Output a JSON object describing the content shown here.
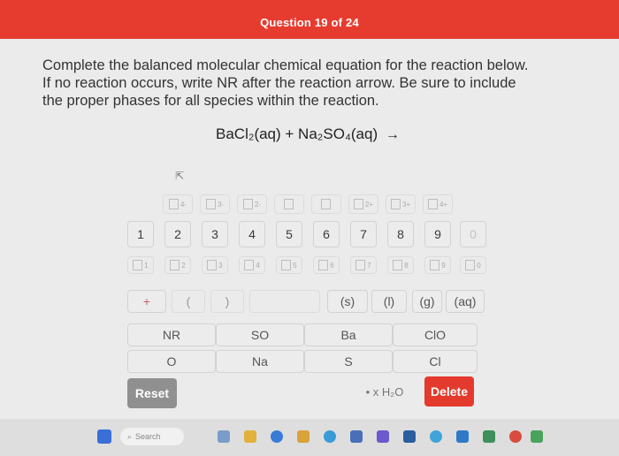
{
  "header": {
    "question_label": "Question 19 of 24"
  },
  "prompt": {
    "line1": "Complete the balanced molecular chemical equation for the reaction below.",
    "line2": "If no reaction occurs, write NR after the reaction arrow. Be sure to include",
    "line3": "the proper phases for all species within the reaction."
  },
  "equation": {
    "text": "BaCl₂(aq) + Na₂SO₄(aq)",
    "arrow": "→"
  },
  "keypad": {
    "charges": [
      "4-",
      "3-",
      "2-",
      "",
      "",
      "2+",
      "3+",
      "4+"
    ],
    "digits": [
      "1",
      "2",
      "3",
      "4",
      "5",
      "6",
      "7",
      "8",
      "9",
      "0"
    ],
    "subscripts": [
      "1",
      "2",
      "3",
      "4",
      "5",
      "6",
      "7",
      "8",
      "9",
      "0"
    ],
    "symbols": [
      "+",
      "(",
      ")",
      "",
      "(s)",
      "(l)",
      "(g)",
      "(aq)"
    ],
    "row_elements1": [
      "NR",
      "SO",
      "Ba",
      "ClO"
    ],
    "row_elements2": [
      "O",
      "Na",
      "S",
      "Cl"
    ],
    "water": "• x H₂O",
    "reset": "Reset",
    "delete": "Delete"
  },
  "taskbar": {
    "search_label": "Search"
  },
  "colors": {
    "accent": "#e63c2f",
    "reset_bg": "#909090",
    "delete_bg": "#e43a2d"
  }
}
